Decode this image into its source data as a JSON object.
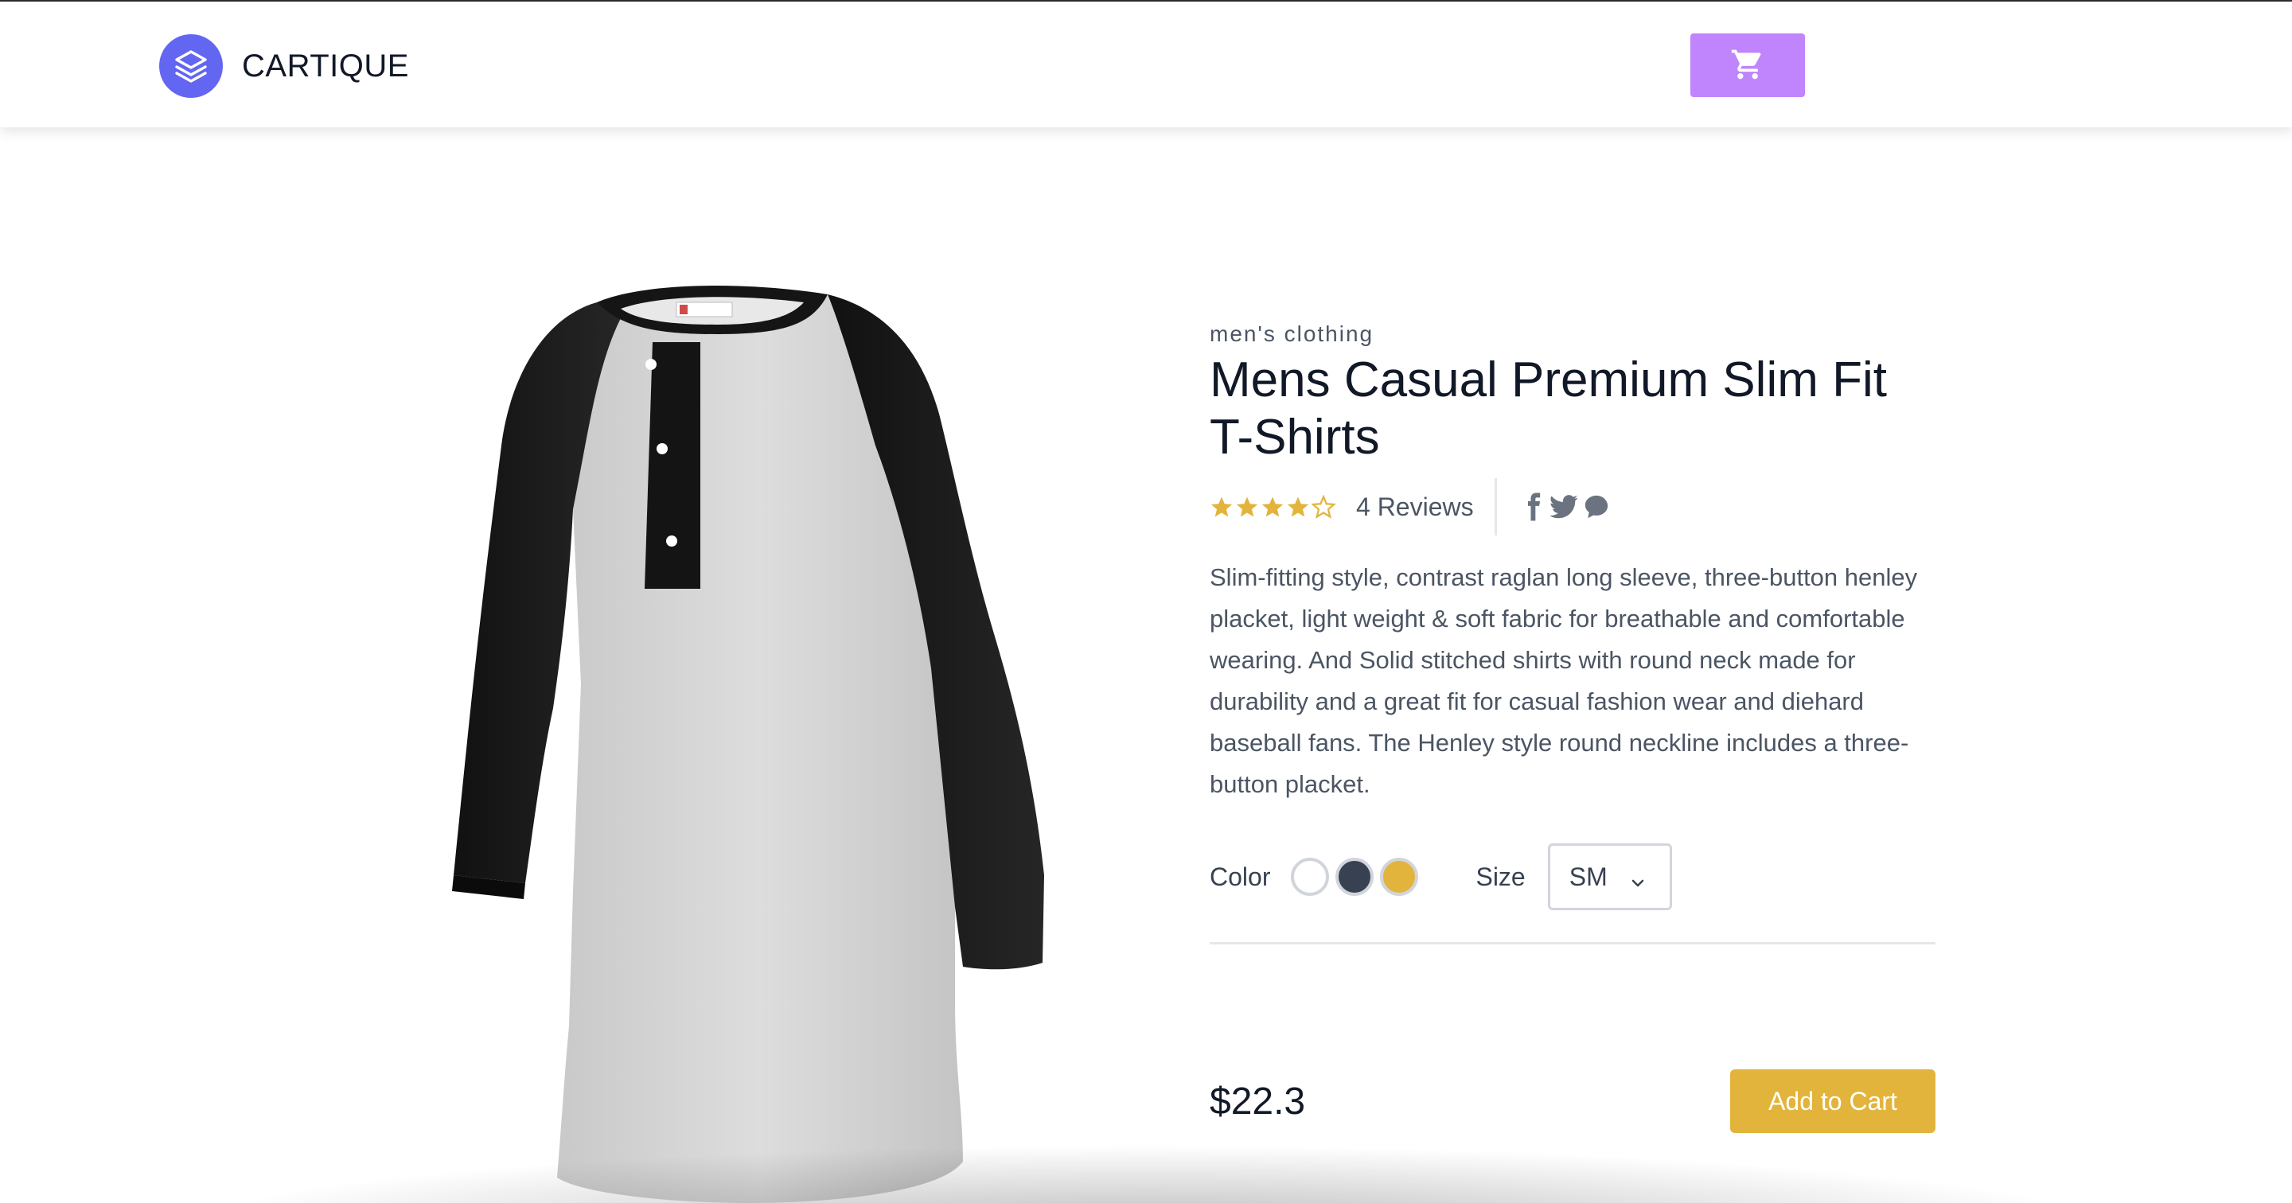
{
  "header": {
    "brand": "CARTIQUE",
    "logo_icon": "stacked-layers-icon",
    "cart_icon": "shopping-cart-icon",
    "colors": {
      "logo_bg": "#6366f1",
      "cart_bg": "#c084fc"
    }
  },
  "product": {
    "image_alt": "Mens Casual Premium Slim Fit T-Shirts",
    "category": "men's clothing",
    "title": "Mens Casual Premium Slim Fit T-Shirts",
    "rating": {
      "value": 4,
      "max": 5,
      "reviews_label": "4 Reviews",
      "star_color": "#e2b43c"
    },
    "social_icons": [
      "facebook-icon",
      "twitter-icon",
      "chat-icon"
    ],
    "description": "Slim-fitting style, contrast raglan long sleeve, three-button henley placket, light weight & soft fabric for breathable and comfortable wearing. And Solid stitched shirts with round neck made for durability and a great fit for casual fashion wear and diehard baseball fans. The Henley style round neckline includes a three-button placket.",
    "color_label": "Color",
    "colors": [
      "#ffffff",
      "#374151",
      "#e2b43c"
    ],
    "size_label": "Size",
    "size_selected": "SM",
    "price": "$22.3",
    "add_to_cart_label": "Add to Cart"
  }
}
